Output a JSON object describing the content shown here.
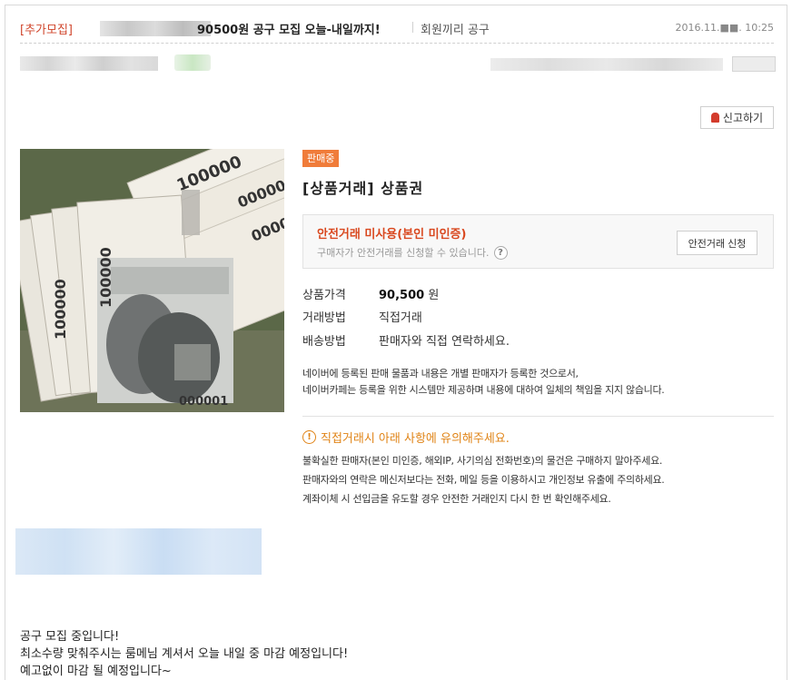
{
  "post": {
    "tag": "[추가모집]",
    "title": "90500원 공구 모집 오늘-내일까지!",
    "board": "회원끼리 공구",
    "date": "2016.11.■■. 10:25"
  },
  "actions": {
    "report": "신고하기"
  },
  "product": {
    "status": "판매중",
    "title": "[상품거래] 상품권",
    "banknote_value": "100000",
    "banknote_serial": "000001"
  },
  "safe_trade": {
    "title": "안전거래 미사용(본인 미인증)",
    "desc": "구매자가 안전거래를 신청할 수 있습니다.",
    "help": "?",
    "button": "안전거래 신청"
  },
  "details": [
    {
      "label": "상품가격",
      "value": "90,500",
      "unit": "원"
    },
    {
      "label": "거래방법",
      "value": "직접거래"
    },
    {
      "label": "배송방법",
      "value": "판매자와 직접 연락하세요."
    }
  ],
  "notice": [
    "네이버에 등록된 판매 물품과 내용은 개별 판매자가 등록한 것으로서,",
    "네이버카페는 등록을 위한 시스템만 제공하며 내용에 대하여 일체의 책임을 지지 않습니다."
  ],
  "warning": {
    "icon": "!",
    "title": "직접거래시 아래 사항에 유의해주세요.",
    "lines": [
      "불확실한 판매자(본인 미인증, 해외IP, 사기의심 전화번호)의 물건은 구매하지 말아주세요.",
      "판매자와의 연락은 메신저보다는 전화, 메일 등을 이용하시고 개인정보 유출에 주의하세요.",
      "계좌이체 시 선입금을 유도할 경우 안전한 거래인지 다시 한 번 확인해주세요."
    ]
  },
  "body": [
    "공구 모집 중입니다!",
    "최소수량 맞춰주시는 룸메님 계셔서 오늘 내일 중 마감 예정입니다!",
    "예고없이 마감 될 예정입니다~"
  ]
}
